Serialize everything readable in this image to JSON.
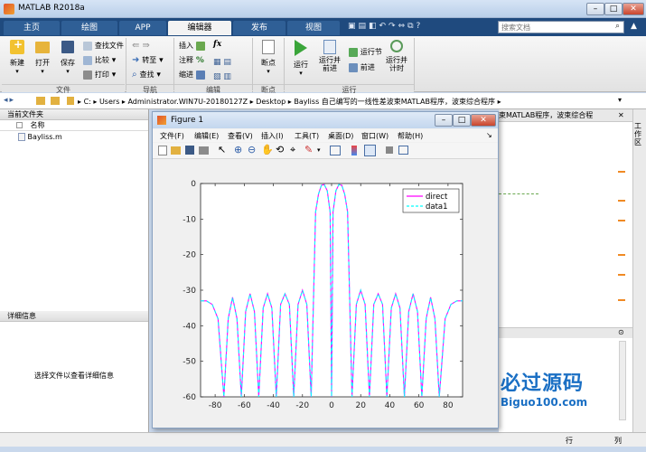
{
  "window": {
    "title": "MATLAB R2018a"
  },
  "tabs": [
    {
      "label": "主页"
    },
    {
      "label": "绘图"
    },
    {
      "label": "APP"
    },
    {
      "label": "编辑器"
    },
    {
      "label": "发布"
    },
    {
      "label": "视图"
    }
  ],
  "search": {
    "placeholder": "搜索文档"
  },
  "ribbon": {
    "file": {
      "new": "新建",
      "open": "打开",
      "save": "保存",
      "find_files": "查找文件",
      "compare": "比较",
      "print": "打印",
      "group": "文件"
    },
    "nav": {
      "goto": "转至",
      "find": "查找",
      "group": "导航"
    },
    "edit": {
      "insert": "插入",
      "comment": "注释",
      "indent": "缩进",
      "fx": "fx",
      "group": "编辑"
    },
    "breakpoints": {
      "label": "断点",
      "group": "断点"
    },
    "run": {
      "run": "运行",
      "run_advance": "运行并\n前进",
      "run_section": "运行节",
      "advance": "前进",
      "run_time": "运行并\n计时",
      "group": "运行"
    }
  },
  "address": {
    "segments": [
      "C:",
      "Users",
      "Administrator.WIN7U-20180127Z",
      "Desktop",
      "Bayliss 自己编写的一线性差波束MATLAB程序，波束综合程序"
    ]
  },
  "current_folder": {
    "header": "当前文件夹",
    "column": "名称",
    "files": [
      "Bayliss.m"
    ]
  },
  "details": {
    "header": "详细信息",
    "message": "选择文件以查看详细信息"
  },
  "editor_tab_text": "束MATLAB程序，波束综合程",
  "side_tab": "工作区",
  "status": {
    "position": "行",
    "col": "列"
  },
  "figure": {
    "title": "Figure 1",
    "menu": [
      "文件(F)",
      "编辑(E)",
      "查看(V)",
      "插入(I)",
      "工具(T)",
      "桌面(D)",
      "窗口(W)",
      "帮助(H)"
    ]
  },
  "watermark": {
    "text": "必过源码",
    "sub": "Biguo100.com"
  },
  "colors": {
    "series_direct": "#ff00ff",
    "series_data1": "#00ffff",
    "accent": "#1f4a7e"
  },
  "chart_data": {
    "type": "line",
    "title": "",
    "xlabel": "",
    "ylabel": "",
    "xlim": [
      -90,
      90
    ],
    "ylim": [
      -60,
      0
    ],
    "xticks": [
      -80,
      -60,
      -40,
      -20,
      0,
      20,
      40,
      60,
      80
    ],
    "yticks": [
      0,
      -10,
      -20,
      -30,
      -40,
      -50,
      -60
    ],
    "legend": {
      "placement": "top-right",
      "entries": [
        "direct",
        "data1"
      ]
    },
    "series": [
      {
        "name": "direct",
        "style": "solid",
        "x": [
          -90,
          -86,
          -82,
          -78,
          -74,
          -71,
          -68,
          -65,
          -62,
          -59,
          -56,
          -53,
          -50,
          -47,
          -44,
          -41,
          -38,
          -35,
          -32,
          -29,
          -26,
          -23,
          -20,
          -17,
          -14,
          -11,
          -9,
          -7,
          -5,
          -3,
          -1,
          0,
          1,
          3,
          5,
          7,
          9,
          11,
          14,
          17,
          20,
          23,
          26,
          29,
          32,
          35,
          38,
          41,
          44,
          47,
          50,
          53,
          56,
          59,
          62,
          65,
          68,
          71,
          74,
          78,
          82,
          86,
          90
        ],
        "y": [
          -33,
          -33,
          -34,
          -38,
          -60,
          -38,
          -32,
          -38,
          -60,
          -36,
          -31,
          -36,
          -60,
          -35,
          -31,
          -35,
          -60,
          -34,
          -31,
          -34,
          -60,
          -34,
          -30,
          -34,
          -60,
          -8,
          -3,
          -0.5,
          -0.3,
          -2,
          -8,
          -60,
          -8,
          -2,
          -0.3,
          -0.5,
          -3,
          -8,
          -60,
          -34,
          -30,
          -34,
          -60,
          -34,
          -31,
          -34,
          -60,
          -35,
          -31,
          -35,
          -60,
          -36,
          -31,
          -36,
          -60,
          -38,
          -32,
          -38,
          -60,
          -38,
          -34,
          -33,
          -33
        ]
      },
      {
        "name": "data1",
        "style": "dashed",
        "x": [
          -90,
          -86,
          -82,
          -78,
          -74,
          -71,
          -68,
          -65,
          -62,
          -59,
          -56,
          -53,
          -50,
          -47,
          -44,
          -41,
          -38,
          -35,
          -32,
          -29,
          -26,
          -23,
          -20,
          -17,
          -14,
          -11,
          -9,
          -7,
          -5,
          -3,
          -1,
          0,
          1,
          3,
          5,
          7,
          9,
          11,
          14,
          17,
          20,
          23,
          26,
          29,
          32,
          35,
          38,
          41,
          44,
          47,
          50,
          53,
          56,
          59,
          62,
          65,
          68,
          71,
          74,
          78,
          82,
          86,
          90
        ],
        "y": [
          -33,
          -33,
          -34,
          -38,
          -60,
          -38,
          -32,
          -38,
          -60,
          -36,
          -31,
          -36,
          -60,
          -35,
          -31,
          -35,
          -60,
          -34,
          -31,
          -34,
          -60,
          -34,
          -30,
          -34,
          -60,
          -8,
          -3,
          -0.5,
          -0.3,
          -2,
          -8,
          -60,
          -8,
          -2,
          -0.3,
          -0.5,
          -3,
          -8,
          -60,
          -34,
          -30,
          -34,
          -60,
          -34,
          -31,
          -34,
          -60,
          -35,
          -31,
          -35,
          -60,
          -36,
          -31,
          -36,
          -60,
          -38,
          -32,
          -38,
          -60,
          -38,
          -34,
          -33,
          -33
        ]
      }
    ]
  }
}
